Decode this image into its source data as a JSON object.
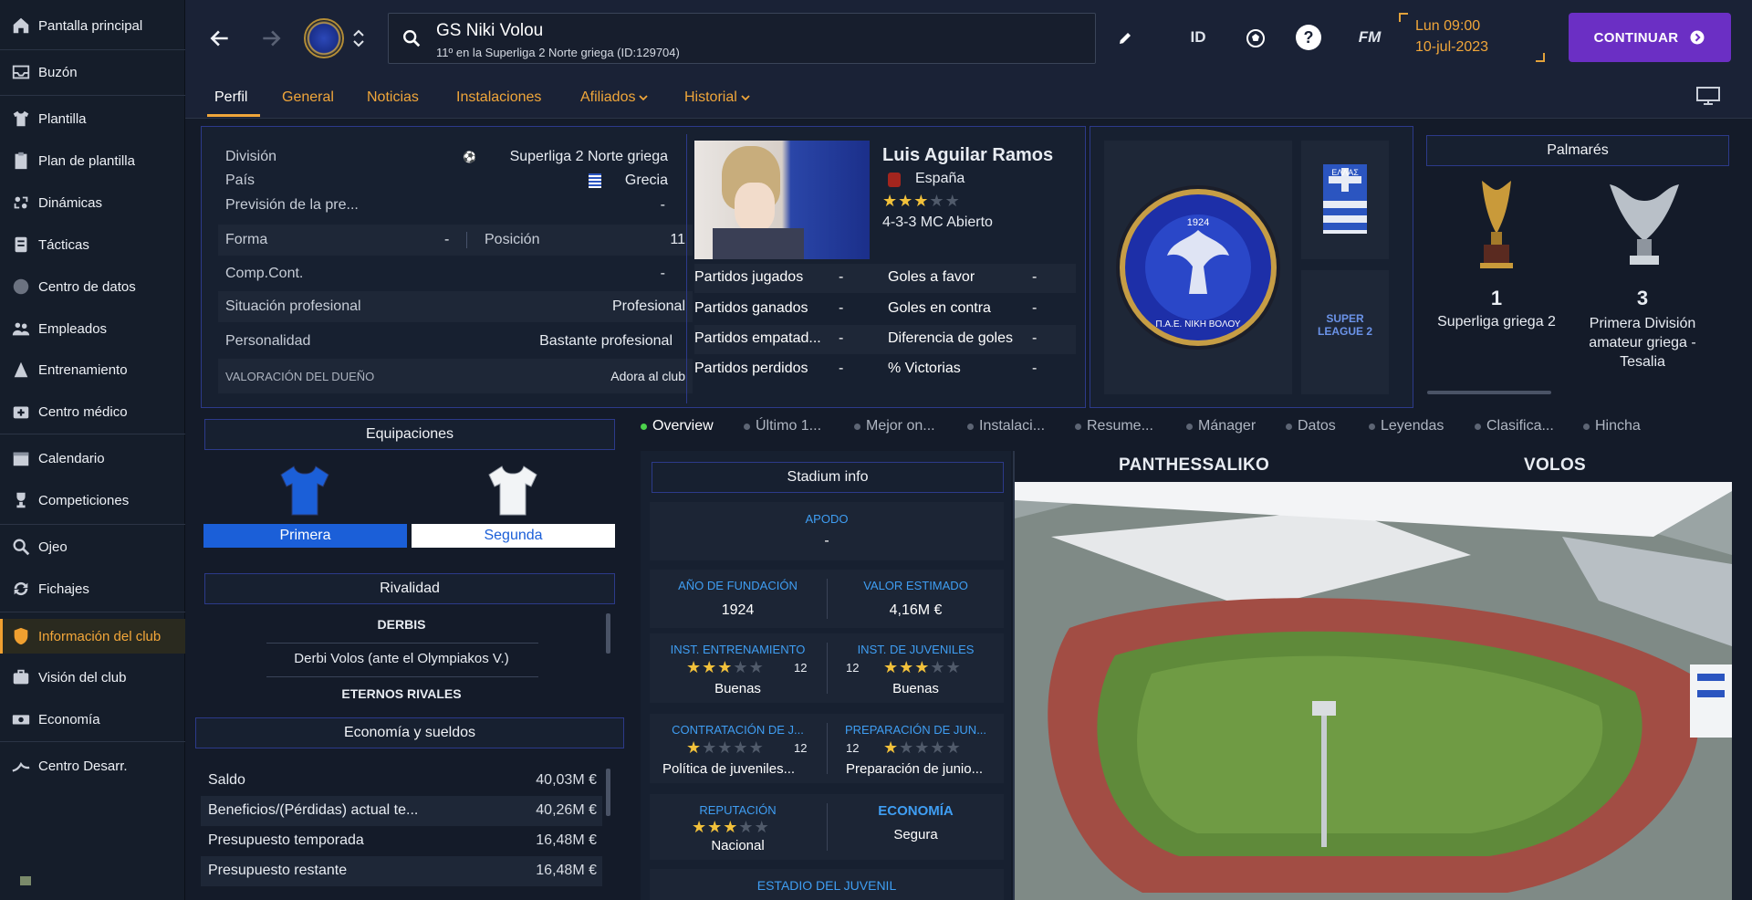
{
  "sidebar": {
    "items": [
      {
        "label": "Pantalla principal",
        "icon": "home-icon"
      },
      {
        "label": "Buzón",
        "icon": "inbox-icon"
      },
      {
        "label": "Plantilla",
        "icon": "shirt-icon"
      },
      {
        "label": "Plan de plantilla",
        "icon": "clipboard-icon"
      },
      {
        "label": "Dinámicas",
        "icon": "dynamics-icon"
      },
      {
        "label": "Tácticas",
        "icon": "tactics-icon"
      },
      {
        "label": "Centro de datos",
        "icon": "data-icon"
      },
      {
        "label": "Empleados",
        "icon": "staff-icon"
      },
      {
        "label": "Entrenamiento",
        "icon": "training-icon"
      },
      {
        "label": "Centro médico",
        "icon": "medical-icon"
      },
      {
        "label": "Calendario",
        "icon": "calendar-icon"
      },
      {
        "label": "Competiciones",
        "icon": "trophy-icon"
      },
      {
        "label": "Ojeo",
        "icon": "scout-icon"
      },
      {
        "label": "Fichajes",
        "icon": "transfers-icon"
      },
      {
        "label": "Información del club",
        "icon": "shield-icon"
      },
      {
        "label": "Visión del club",
        "icon": "vision-icon"
      },
      {
        "label": "Economía",
        "icon": "money-icon"
      },
      {
        "label": "Centro Desarr.",
        "icon": "development-icon"
      }
    ],
    "active_index": 14
  },
  "topbar": {
    "club_name": "GS Niki Volou",
    "club_subtitle": "11º en la Superliga 2 Norte griega (ID:129704)",
    "id_label": "ID",
    "help_label": "?",
    "fm_label": "FM",
    "date_day": "Lun 09:00",
    "date_date": "10-jul-2023",
    "continue_label": "CONTINUAR"
  },
  "tabs": [
    {
      "label": "Perfil",
      "active": true,
      "dropdown": false
    },
    {
      "label": "General",
      "active": false,
      "dropdown": false
    },
    {
      "label": "Noticias",
      "active": false,
      "dropdown": false
    },
    {
      "label": "Instalaciones",
      "active": false,
      "dropdown": false
    },
    {
      "label": "Afiliados",
      "active": false,
      "dropdown": true
    },
    {
      "label": "Historial",
      "active": false,
      "dropdown": true
    }
  ],
  "profile": {
    "division_label": "División",
    "division_value": "Superliga 2 Norte griega",
    "country_label": "País",
    "country_value": "Grecia",
    "forecast_label": "Previsión de la pre...",
    "forecast_value": "-",
    "form_label": "Forma",
    "form_value": "-",
    "position_label": "Posición",
    "position_value": "11",
    "comp_label": "Comp.Cont.",
    "comp_value": "-",
    "status_label": "Situación profesional",
    "status_value": "Profesional",
    "personality_label": "Personalidad",
    "personality_value": "Bastante profesional",
    "owner_label": "VALORACIÓN DEL DUEÑO",
    "owner_value": "Adora al club"
  },
  "manager": {
    "name": "Luis Aguilar Ramos",
    "nation": "España",
    "stars": 3,
    "tactic": "4-3-3 MC Abierto",
    "stats": [
      {
        "label": "Partidos jugados",
        "value": "-"
      },
      {
        "label": "Goles a favor",
        "value": "-"
      },
      {
        "label": "Partidos ganados",
        "value": "-"
      },
      {
        "label": "Goles en contra",
        "value": "-"
      },
      {
        "label": "Partidos empatad...",
        "value": "-"
      },
      {
        "label": "Diferencia de goles",
        "value": "-"
      },
      {
        "label": "Partidos perdidos",
        "value": "-"
      },
      {
        "label": "% Victorias",
        "value": "-"
      }
    ]
  },
  "crest": {
    "year": "1924",
    "text": "Π.Α.Ε. ΝΙΚΗ ΒΟΛΟΥ",
    "flag_text": "ΕΛΛΑΣ",
    "league_text": "SUPER LEAGUE 2"
  },
  "palmares": {
    "title": "Palmarés",
    "trophies": [
      {
        "count": "1",
        "name": "Superliga griega 2"
      },
      {
        "count": "3",
        "name": "Primera División amateur griega - Tesalia"
      }
    ]
  },
  "kits": {
    "title": "Equipaciones",
    "first": "Primera",
    "second": "Segunda"
  },
  "rivalry": {
    "title": "Rivalidad",
    "derbies_label": "DERBIS",
    "derby": "Derbi Volos (ante el Olympiakos V.)",
    "rivals_label": "ETERNOS RIVALES"
  },
  "finance": {
    "title": "Economía y sueldos",
    "rows": [
      {
        "label": "Saldo",
        "value": "40,03M €"
      },
      {
        "label": "Beneficios/(Pérdidas) actual te...",
        "value": "40,26M €"
      },
      {
        "label": "Presupuesto temporada",
        "value": "16,48M €"
      },
      {
        "label": "Presupuesto restante",
        "value": "16,48M €"
      }
    ]
  },
  "subtabs": [
    "Overview",
    "Último 1...",
    "Mejor on...",
    "Instalaci...",
    "Resume...",
    "Mánager",
    "Datos",
    "Leyendas",
    "Clasifica...",
    "Hincha"
  ],
  "stadium_info": {
    "title": "Stadium info",
    "apodo_label": "APODO",
    "apodo_value": "-",
    "founded_label": "AÑO DE FUNDACIÓN",
    "founded_value": "1924",
    "value_label": "VALOR ESTIMADO",
    "value_value": "4,16M €",
    "training_label": "INST. ENTRENAMIENTO",
    "training_num": "12",
    "training_value": "Buenas",
    "training_stars": 3,
    "youth_label": "INST. DE JUVENILES",
    "youth_num": "12",
    "youth_value": "Buenas",
    "youth_stars": 3,
    "recruit_label": "CONTRATACIÓN DE J...",
    "recruit_num": "12",
    "recruit_value": "Política de juveniles...",
    "recruit_stars": 1,
    "prep_label": "PREPARACIÓN DE JUN...",
    "prep_num": "12",
    "prep_value": "Preparación de junio...",
    "prep_stars": 1,
    "rep_label": "REPUTACIÓN",
    "rep_value": "Nacional",
    "rep_stars": 3,
    "eco_label": "ECONOMÍA",
    "eco_value": "Segura",
    "youth_stadium_label": "ESTADIO DEL JUVENIL"
  },
  "stadium": {
    "name": "PANTHESSALIKO",
    "city": "VOLOS"
  },
  "colors": {
    "accent": "#f0a63a",
    "continue": "#6b2fc4",
    "primary_kit": "#1b5fd8",
    "panel_border": "#2c3a8a",
    "info_blue": "#3f9ef3"
  }
}
